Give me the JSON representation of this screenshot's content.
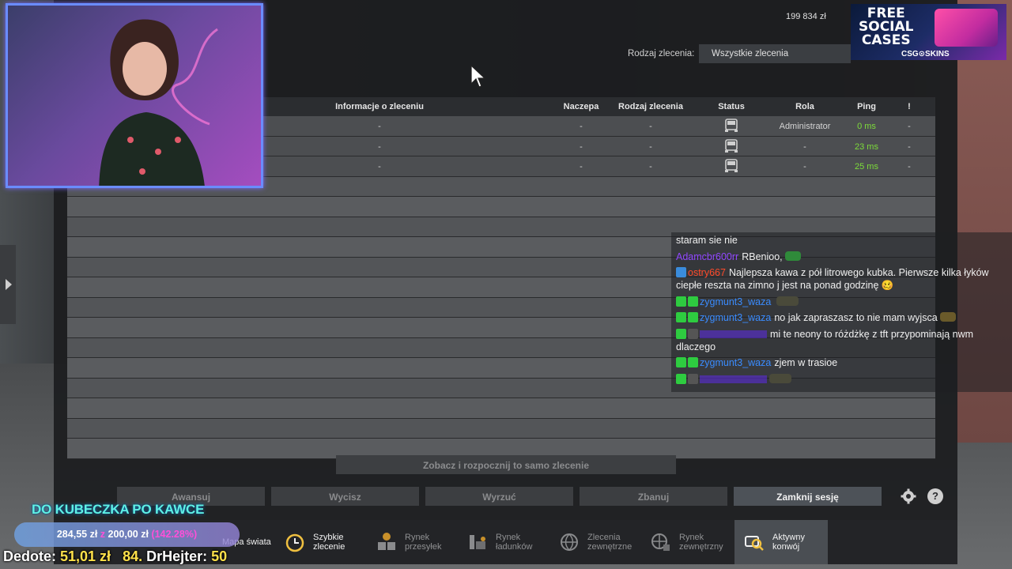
{
  "header": {
    "money": "199 834 zł",
    "filter_label": "Rodzaj zlecenia:",
    "filter_value": "Wszystkie zlecenia"
  },
  "table": {
    "columns": [
      "Informacje o zleceniu",
      "Naczepa",
      "Rodzaj zlecenia",
      "Status",
      "Rola",
      "Ping",
      "!"
    ],
    "rows": [
      {
        "info": "-",
        "trailer": "-",
        "type": "-",
        "status_icon": "truck-icon",
        "role": "Administrator",
        "ping": "0 ms",
        "flag": "-"
      },
      {
        "info": "-",
        "trailer": "-",
        "type": "-",
        "status_icon": "truck-icon",
        "role": "-",
        "ping": "23 ms",
        "flag": "-"
      },
      {
        "info": "-",
        "trailer": "-",
        "type": "-",
        "status_icon": "truck-icon",
        "role": "-",
        "ping": "25 ms",
        "flag": "-"
      }
    ],
    "ping_color": "#7ddc3a"
  },
  "actions": {
    "main": "Zobacz i rozpocznij to samo zlecenie",
    "buttons": [
      "Awansuj",
      "Wycisz",
      "Wyrzuć",
      "Zbanuj",
      "Zamknij sesję"
    ],
    "settings_icon": "gear-icon",
    "help_label": "?"
  },
  "nav": {
    "items": [
      {
        "label": "Mapa świata",
        "icon": "map-icon"
      },
      {
        "label": "Szybkie zlecenie",
        "icon": "clock-icon"
      },
      {
        "label": "Rynek przesyłek",
        "icon": "boxes-icon"
      },
      {
        "label": "Rynek ładunków",
        "icon": "cargo-icon"
      },
      {
        "label": "Zlecenia zewnętrzne",
        "icon": "globe-icon"
      },
      {
        "label": "Rynek zewnętrzny",
        "icon": "globe-cargo-icon"
      },
      {
        "label": "Aktywny konwój",
        "icon": "convoy-search-icon"
      }
    ]
  },
  "ad": {
    "title_line1": "FREE",
    "title_line2": "SOCIAL",
    "title_line3": "CASES",
    "brand": "CSG⊙SKINS"
  },
  "chat": {
    "messages": [
      {
        "user": "",
        "text": "staram sie nie",
        "user_color": ""
      },
      {
        "user": "Adamcbr600rr",
        "text": "RBenioo,",
        "user_color": "#9147ff"
      },
      {
        "user": "ostry667",
        "text": "Najlepsza kawa z pół litrowego kubka. Pierwsze kilka łyków ciepłe reszta na zimno j jest na ponad godzinę 🥴",
        "user_color": "#ff4a2a"
      },
      {
        "user": "zygmunt3_waza",
        "text": "",
        "user_color": "#3a8cff"
      },
      {
        "user": "zygmunt3_waza",
        "text": "no jak zapraszasz to nie mam wyjsca",
        "user_color": "#3a8cff"
      },
      {
        "user": "",
        "text": "mi te neony to różdżkę z tft przypominają nwm dlaczego",
        "user_color": "#6a2bff"
      },
      {
        "user": "zygmunt3_waza",
        "text": "zjem w trasioe",
        "user_color": "#3a8cff"
      },
      {
        "user": "",
        "text": "",
        "user_color": "#6a2bff"
      }
    ]
  },
  "overlay": {
    "title": "DO KUBECZKA PO KAWCE",
    "goal_current": "284,55 zł",
    "goal_sep": "z",
    "goal_target": "200,00 zł",
    "goal_pct": "(142.28%)",
    "goal_fraction": 1.0,
    "ticker_left": "Dedote:",
    "ticker_left_value": "51,01 zł",
    "ticker_right_prefix": "84.",
    "ticker_right": "DrHejter:",
    "ticker_right_value": "50"
  }
}
